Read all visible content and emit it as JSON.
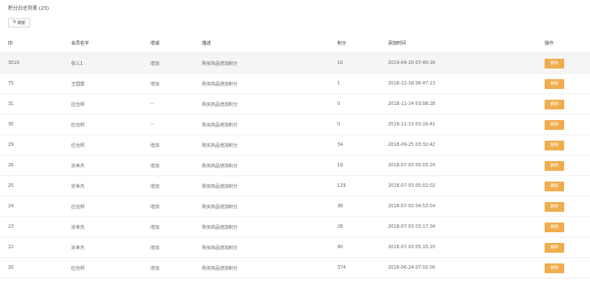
{
  "header": {
    "title": "积分日志列表 (23)"
  },
  "toolbar": {
    "refresh_label": "刷新",
    "refresh_icon": "↻"
  },
  "table": {
    "columns": [
      "ID",
      "会员名字",
      "增减",
      "描述",
      "积分",
      "添加时间",
      "操作"
    ],
    "delete_label": "删除",
    "rows": [
      {
        "id": "3010",
        "name": "张三1",
        "change": "增加",
        "desc": "购买商品增加积分",
        "points": "10",
        "time": "2019-04-20 07:40:16"
      },
      {
        "id": "75",
        "name": "王国斌",
        "change": "增加",
        "desc": "购买商品增加积分",
        "points": "1",
        "time": "2018-12-18 06:47:13"
      },
      {
        "id": "31",
        "name": "应治邦",
        "change": "--",
        "desc": "购买商品增加积分",
        "points": "0",
        "time": "2018-11-14 03:08:28"
      },
      {
        "id": "30",
        "name": "应治邦",
        "change": "--",
        "desc": "购买商品增加积分",
        "points": "0",
        "time": "2018-11-13 03:16:41"
      },
      {
        "id": "29",
        "name": "应治邦",
        "change": "增加",
        "desc": "购买商品增加积分",
        "points": "34",
        "time": "2018-09-25 03:32:42"
      },
      {
        "id": "26",
        "name": "宗世杰",
        "change": "增加",
        "desc": "购买商品增加积分",
        "points": "19",
        "time": "2018-07-03 05:03:24"
      },
      {
        "id": "25",
        "name": "宗世杰",
        "change": "增加",
        "desc": "购买商品增加积分",
        "points": "129",
        "time": "2018-07-03 05:02:02"
      },
      {
        "id": "24",
        "name": "应治邦",
        "change": "增加",
        "desc": "购买商品增加积分",
        "points": "38",
        "time": "2018-07-03 04:53:54"
      },
      {
        "id": "23",
        "name": "宗世杰",
        "change": "增加",
        "desc": "购买商品增加积分",
        "points": "28",
        "time": "2018-07-03 03:17:34"
      },
      {
        "id": "22",
        "name": "宗世杰",
        "change": "增加",
        "desc": "购买商品增加积分",
        "points": "40",
        "time": "2018-07-03 05:15:10"
      },
      {
        "id": "20",
        "name": "应治邦",
        "change": "增加",
        "desc": "购买商品增加积分",
        "points": "374",
        "time": "2018-06-24 07:02:00"
      }
    ]
  },
  "colors": {
    "delete_button": "#f0ad4e",
    "highlight_row": "#f5f5f5"
  }
}
